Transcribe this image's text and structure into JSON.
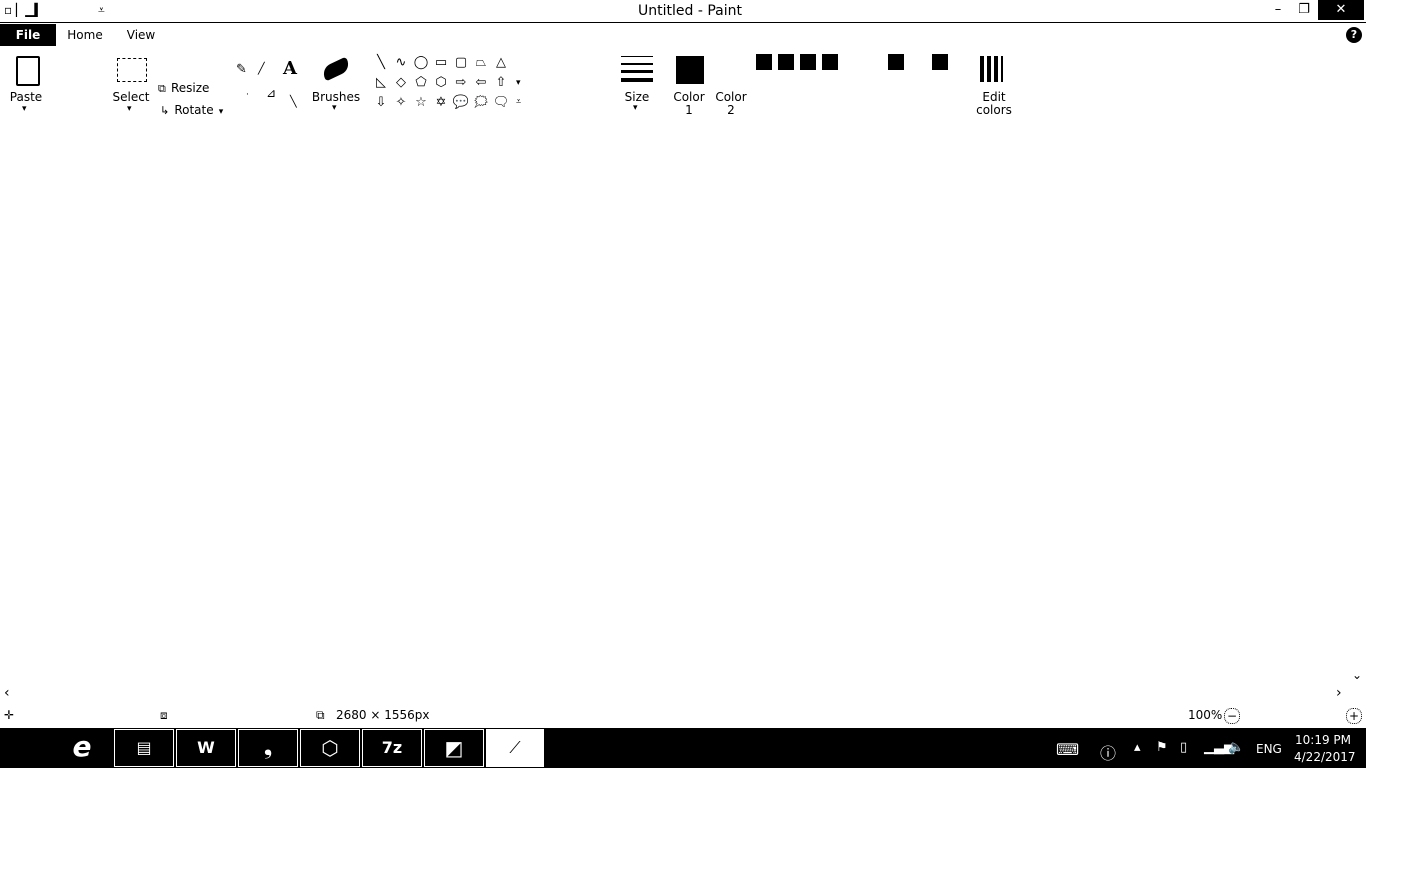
{
  "window": {
    "title": "Untitled - Paint",
    "minimize": "–",
    "restore": "❐",
    "close": "✕"
  },
  "qat": {
    "glyphs": "▫ ▏▁▍",
    "customize": "⩡"
  },
  "menu": {
    "file": "File",
    "home": "Home",
    "view": "View",
    "help": "?"
  },
  "ribbon": {
    "clipboard": {
      "paste": "Paste"
    },
    "image": {
      "select": "Select",
      "resize": "Resize",
      "rotate": "Rotate"
    },
    "tools": {
      "text_tool": "A"
    },
    "brushes": "Brushes",
    "shapes": [
      "╲",
      "∿",
      "◯",
      "▭",
      "▢",
      "⏢",
      "△",
      "◺",
      "◇",
      "⬠",
      "⬡",
      "⇨",
      "⇦",
      "⇧",
      "⇩",
      "✧",
      "☆",
      "✡",
      "💬",
      "🗯",
      "🗨"
    ],
    "size": "Size",
    "color1": [
      "Color",
      "1"
    ],
    "color2": [
      "Color",
      "2"
    ],
    "edit_colors": [
      "Edit",
      "colors"
    ],
    "collapse": "^"
  },
  "status": {
    "canvas_size": "2680 × 1556px",
    "zoom": "100%",
    "zoom_out": "−",
    "zoom_in": "+"
  },
  "taskbar": {
    "apps": [
      "e",
      "▤",
      "W",
      "❟",
      "⬡",
      "7z",
      "◩",
      "⟋"
    ],
    "tray": {
      "lang": "ENG",
      "time": "10:19 PM",
      "date": "4/22/2017"
    }
  }
}
